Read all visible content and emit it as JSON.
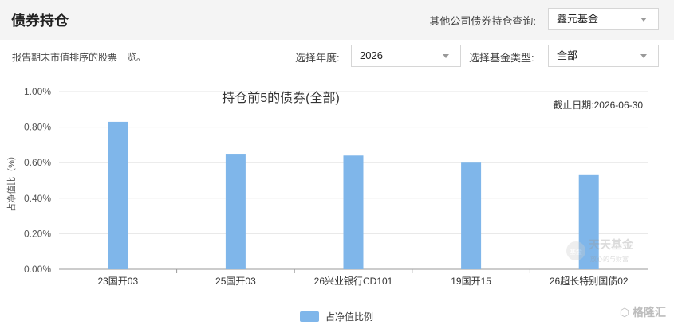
{
  "header": {
    "title": "债券持仓",
    "query_label": "其他公司债券持仓查询:",
    "company_select": "鑫元基金"
  },
  "filters": {
    "subtitle": "报告期末市值排序的股票一览。",
    "year_label": "选择年度:",
    "year_value": "2026",
    "type_label": "选择基金类型:",
    "type_value": "全部"
  },
  "colors": {
    "bar": "#7fb6ea",
    "grid": "#e6e6e6"
  },
  "watermark": {
    "logo_text": "天天基金",
    "logo_sub": "放心的与财富",
    "brand": "格隆汇"
  },
  "chart_data": {
    "type": "bar",
    "title": "持仓前5的债券(全部)",
    "date_note": "截止日期:2026-06-30",
    "ylabel": "占净值比（%）",
    "ylim": [
      0,
      1.0
    ],
    "yticks": [
      "0.00%",
      "0.20%",
      "0.40%",
      "0.60%",
      "0.80%",
      "1.00%"
    ],
    "categories": [
      "23国开03",
      "25国开03",
      "26兴业银行CD101",
      "19国开15",
      "26超长特别国债02"
    ],
    "series": [
      {
        "name": "占净值比例",
        "values": [
          0.83,
          0.65,
          0.64,
          0.6,
          0.53
        ]
      }
    ],
    "legend_position": "bottom-center",
    "grid": true
  }
}
